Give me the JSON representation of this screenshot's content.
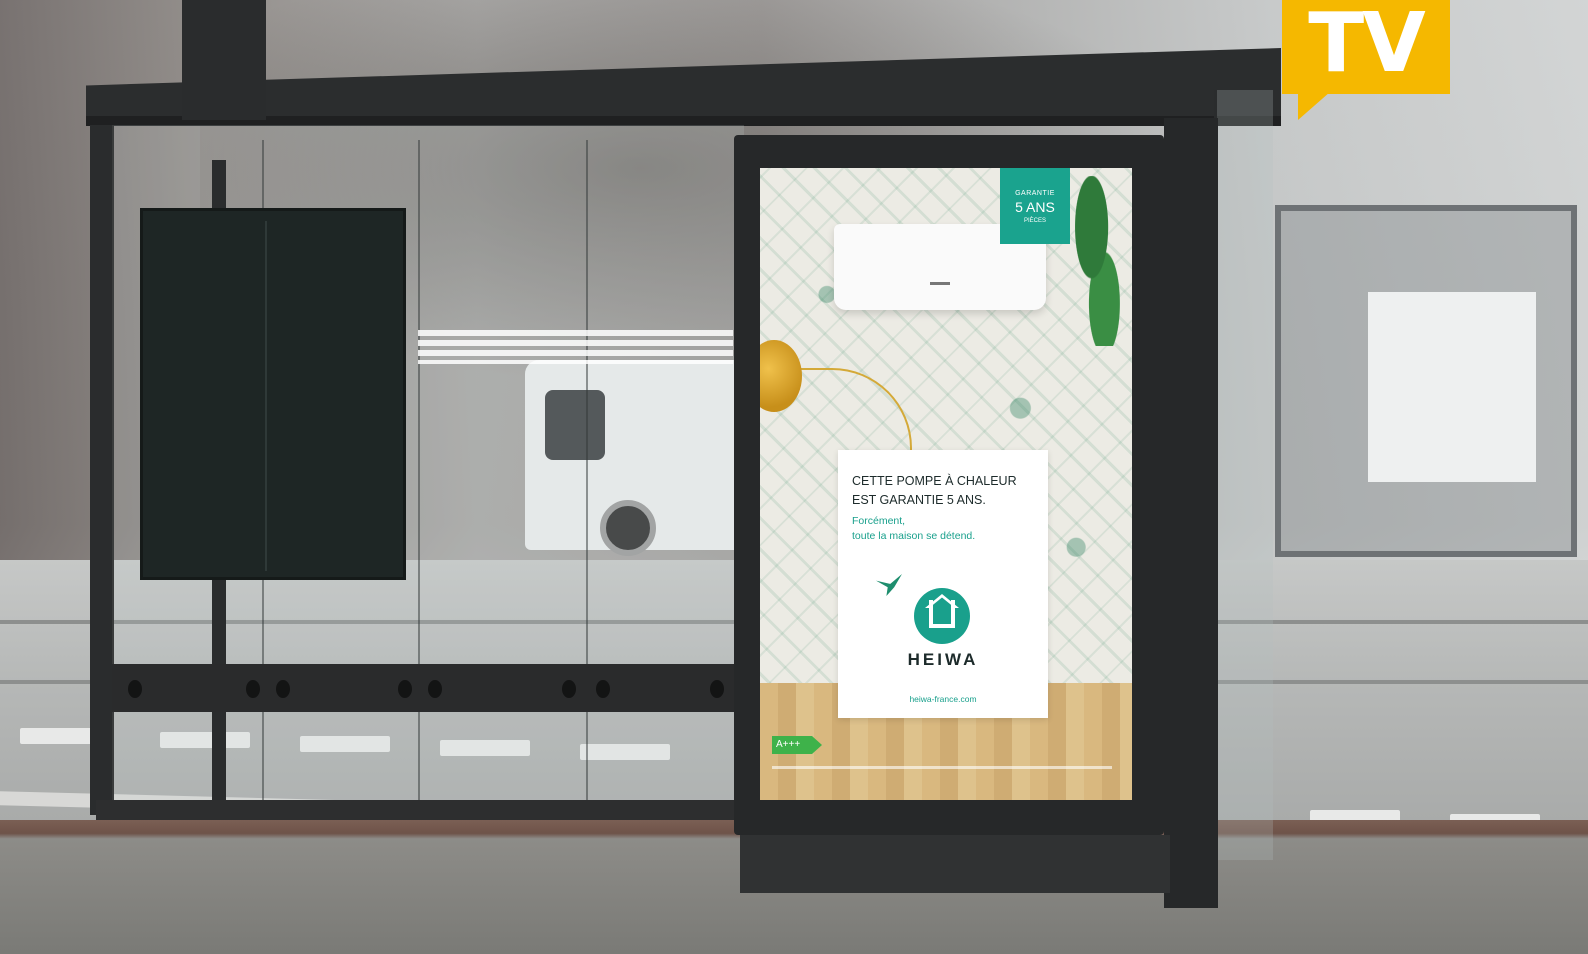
{
  "tv_badge": {
    "label": "TV",
    "color": "#f5b800"
  },
  "poster": {
    "badge": {
      "top": "GARANTIE",
      "main": "5 ANS",
      "bottom": "PIÈCES"
    },
    "headline_line1": "CETTE POMPE À CHALEUR",
    "headline_line2": "EST GARANTIE 5 ANS.",
    "tagline_line1": "Forcément,",
    "tagline_line2": "toute la maison se détend.",
    "brand": "HEIWA",
    "url": "heiwa-france.com",
    "energy_class": "A+++",
    "brand_color": "#19a08c"
  }
}
